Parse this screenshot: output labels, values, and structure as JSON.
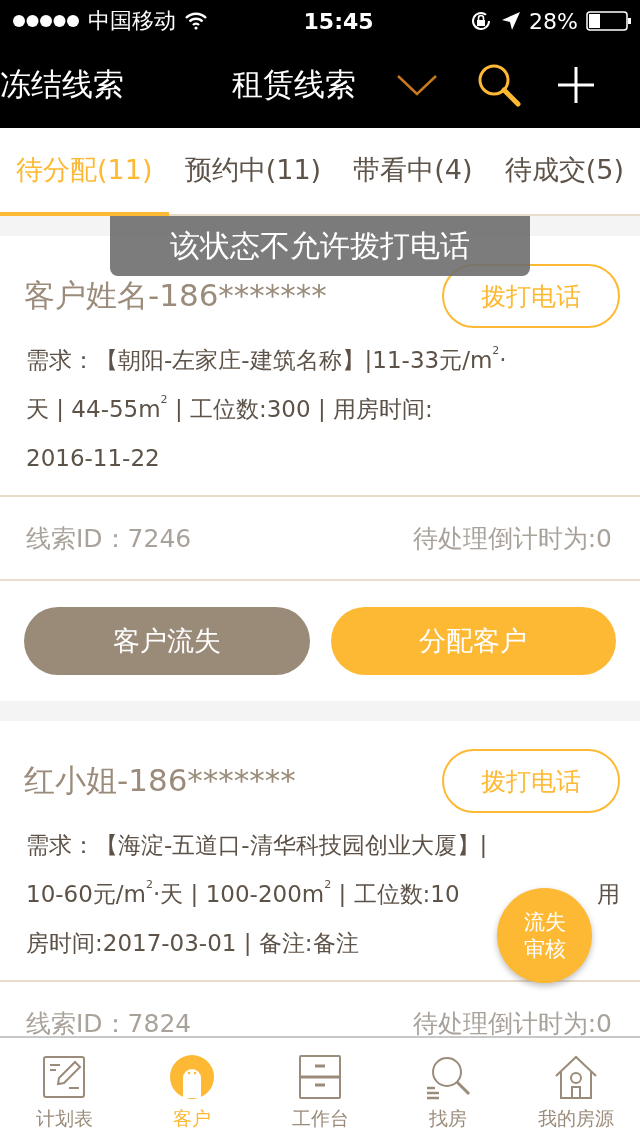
{
  "status_bar": {
    "carrier": "中国移动",
    "time": "15:45",
    "battery": "28%"
  },
  "nav": {
    "left_title": "冻结线索",
    "title": "租赁线索"
  },
  "tabs": [
    {
      "label": "待分配(11)",
      "selected": true
    },
    {
      "label": "预约中(11)",
      "selected": false
    },
    {
      "label": "带看中(4)",
      "selected": false
    },
    {
      "label": "待成交(5)",
      "selected": false
    }
  ],
  "toast": "该状态不允许拨打电话",
  "cards": [
    {
      "name": "客户姓名-186*******",
      "call_button": "拨打电话",
      "lines": [
        {
          "text": "需求：【朝阳-左家庄-建筑名称】|11-33元/m$^{2}$·"
        },
        {
          "text": "天 | 44-55m$^{2}$ | 工位数:300 | 用房时间:"
        },
        {
          "text": "2016-11-22"
        }
      ],
      "lead_id": "线索ID：7246",
      "countdown": "待处理倒计时为:0",
      "actions": [
        {
          "label": "客户流失",
          "kind": "secondary"
        },
        {
          "label": "分配客户",
          "kind": "primary"
        }
      ]
    },
    {
      "name": "红小姐-186*******",
      "call_button": "拨打电话",
      "lines": [
        {
          "text": "需求：【海淀-五道口-清华科技园创业大厦】|"
        },
        {
          "text": "10-60元/m$^{2}$·天 | 100-200m$^{2}$ | 工位数:10",
          "end": "用"
        },
        {
          "text": "房时间:2017-03-01 | 备注:备注"
        }
      ],
      "lead_id": "线索ID：7824",
      "countdown": "待处理倒计时为:0"
    }
  ],
  "fab": {
    "line1": "流失",
    "line2": "审核"
  },
  "bottom_tabs": [
    {
      "label": "计划表",
      "selected": false
    },
    {
      "label": "客户",
      "selected": true
    },
    {
      "label": "工作台",
      "selected": false
    },
    {
      "label": "找房",
      "selected": false
    },
    {
      "label": "我的房源",
      "selected": false
    }
  ]
}
